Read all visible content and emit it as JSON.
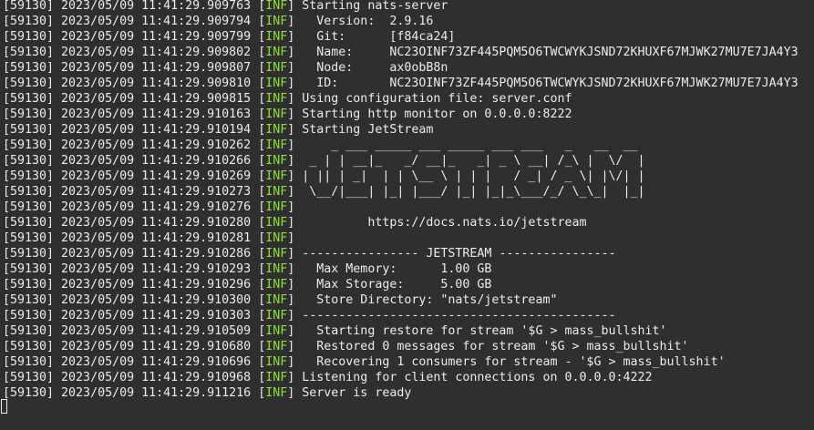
{
  "terminal": {
    "lines": [
      {
        "prefix": "[59130] 2023/05/09 11:41:29.909763 ",
        "level": "INF",
        "message": "Starting nats-server"
      },
      {
        "prefix": "[59130] 2023/05/09 11:41:29.909794 ",
        "level": "INF",
        "message": "  Version:  2.9.16"
      },
      {
        "prefix": "[59130] 2023/05/09 11:41:29.909799 ",
        "level": "INF",
        "message": "  Git:      [f84ca24]"
      },
      {
        "prefix": "[59130] 2023/05/09 11:41:29.909802 ",
        "level": "INF",
        "message": "  Name:     NC23OINF73ZF445PQM5O6TWCWYKJSND72KHUXF67MJWK27MU7E7JA4Y3"
      },
      {
        "prefix": "[59130] 2023/05/09 11:41:29.909807 ",
        "level": "INF",
        "message": "  Node:     ax0obB8n"
      },
      {
        "prefix": "[59130] 2023/05/09 11:41:29.909810 ",
        "level": "INF",
        "message": "  ID:       NC23OINF73ZF445PQM5O6TWCWYKJSND72KHUXF67MJWK27MU7E7JA4Y3"
      },
      {
        "prefix": "[59130] 2023/05/09 11:41:29.909815 ",
        "level": "INF",
        "message": "Using configuration file: server.conf"
      },
      {
        "prefix": "[59130] 2023/05/09 11:41:29.910163 ",
        "level": "INF",
        "message": "Starting http monitor on 0.0.0.0:8222"
      },
      {
        "prefix": "[59130] 2023/05/09 11:41:29.910194 ",
        "level": "INF",
        "message": "Starting JetStream"
      },
      {
        "prefix": "[59130] 2023/05/09 11:41:29.910262 ",
        "level": "INF",
        "message": "    _ ___ _____ ___ _____ ___ ___   _   __  __"
      },
      {
        "prefix": "[59130] 2023/05/09 11:41:29.910266 ",
        "level": "INF",
        "message": " _ | | __|_   _/ __|_   _| _ \\ __| /_\\ |  \\/  |"
      },
      {
        "prefix": "[59130] 2023/05/09 11:41:29.910269 ",
        "level": "INF",
        "message": "| || | _|  | | \\__ \\ | | |   / _| / _ \\| |\\/| |"
      },
      {
        "prefix": "[59130] 2023/05/09 11:41:29.910273 ",
        "level": "INF",
        "message": " \\__/|___| |_| |___/ |_| |_|_\\___/_/ \\_\\_|  |_|"
      },
      {
        "prefix": "[59130] 2023/05/09 11:41:29.910276 ",
        "level": "INF",
        "message": ""
      },
      {
        "prefix": "[59130] 2023/05/09 11:41:29.910280 ",
        "level": "INF",
        "message": "         https://docs.nats.io/jetstream"
      },
      {
        "prefix": "[59130] 2023/05/09 11:41:29.910281 ",
        "level": "INF",
        "message": ""
      },
      {
        "prefix": "[59130] 2023/05/09 11:41:29.910286 ",
        "level": "INF",
        "message": "---------------- JETSTREAM ----------------"
      },
      {
        "prefix": "[59130] 2023/05/09 11:41:29.910293 ",
        "level": "INF",
        "message": "  Max Memory:      1.00 GB"
      },
      {
        "prefix": "[59130] 2023/05/09 11:41:29.910296 ",
        "level": "INF",
        "message": "  Max Storage:     5.00 GB"
      },
      {
        "prefix": "[59130] 2023/05/09 11:41:29.910300 ",
        "level": "INF",
        "message": "  Store Directory: \"nats/jetstream\""
      },
      {
        "prefix": "[59130] 2023/05/09 11:41:29.910303 ",
        "level": "INF",
        "message": "-------------------------------------------"
      },
      {
        "prefix": "[59130] 2023/05/09 11:41:29.910509 ",
        "level": "INF",
        "message": "  Starting restore for stream '$G > mass_bullshit'"
      },
      {
        "prefix": "[59130] 2023/05/09 11:41:29.910680 ",
        "level": "INF",
        "message": "  Restored 0 messages for stream '$G > mass_bullshit'"
      },
      {
        "prefix": "[59130] 2023/05/09 11:41:29.910696 ",
        "level": "INF",
        "message": "  Recovering 1 consumers for stream - '$G > mass_bullshit'"
      },
      {
        "prefix": "[59130] 2023/05/09 11:41:29.910968 ",
        "level": "INF",
        "message": "Listening for client connections on 0.0.0.0:4222"
      },
      {
        "prefix": "[59130] 2023/05/09 11:41:29.911216 ",
        "level": "INF",
        "message": "Server is ready"
      }
    ]
  },
  "colors": {
    "background": "#2f2f2f",
    "foreground": "#ebebeb",
    "level_tag": "#8ae234"
  }
}
